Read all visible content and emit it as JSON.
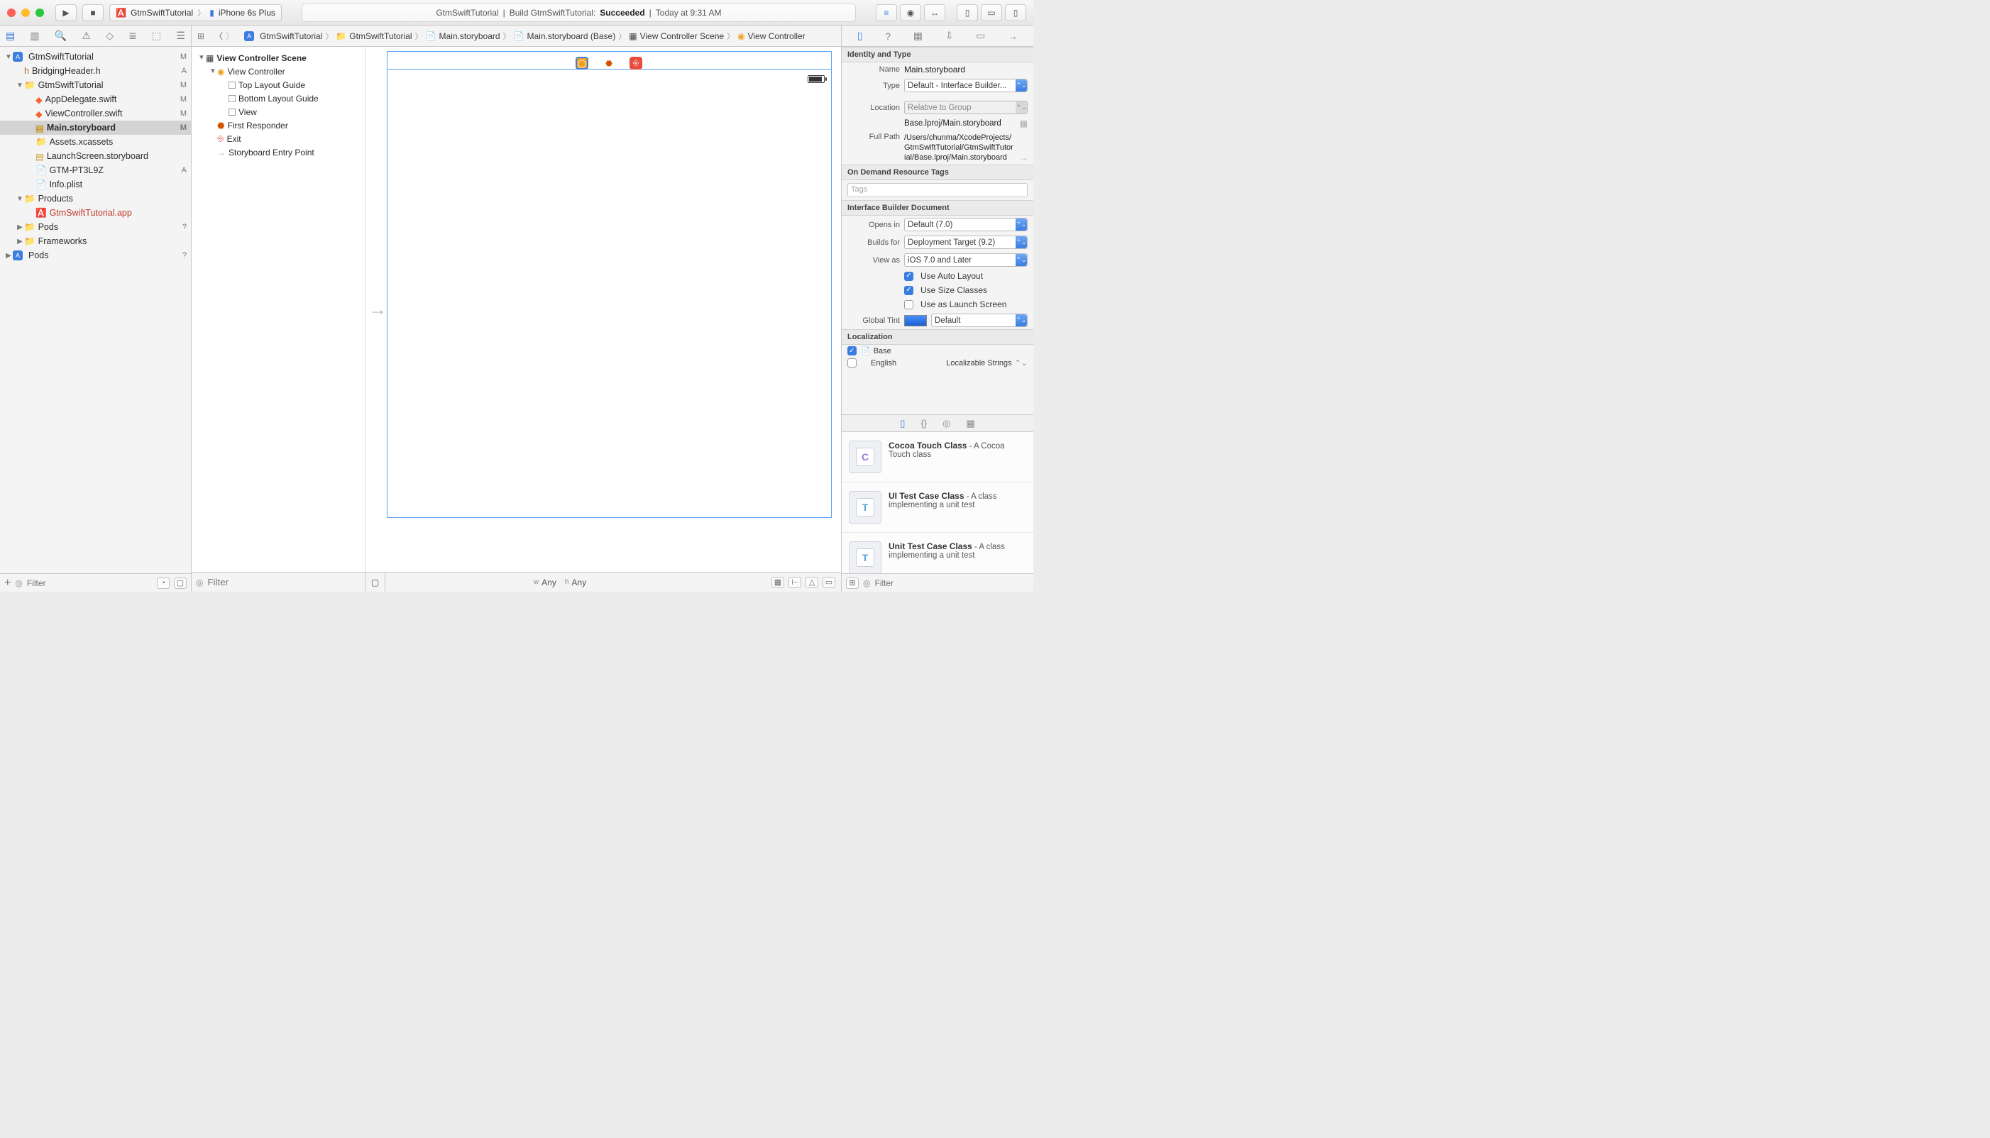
{
  "toolbar": {
    "scheme_target": "GtmSwiftTutorial",
    "scheme_device": "iPhone 6s Plus"
  },
  "status": {
    "project": "GtmSwiftTutorial",
    "action": "Build GtmSwiftTutorial:",
    "result": "Succeeded",
    "time": "Today at 9:31 AM"
  },
  "breadcrumb": [
    "GtmSwiftTutorial",
    "GtmSwiftTutorial",
    "Main.storyboard",
    "Main.storyboard (Base)",
    "View Controller Scene",
    "View Controller"
  ],
  "navigator": {
    "rows": [
      {
        "indent": 0,
        "disc": "▼",
        "icon": "proj",
        "label": "GtmSwiftTutorial",
        "badge": "M"
      },
      {
        "indent": 1,
        "disc": "",
        "icon": "h",
        "label": "BridgingHeader.h",
        "badge": "A"
      },
      {
        "indent": 1,
        "disc": "▼",
        "icon": "folder",
        "label": "GtmSwiftTutorial",
        "badge": "M"
      },
      {
        "indent": 2,
        "disc": "",
        "icon": "swift",
        "label": "AppDelegate.swift",
        "badge": "M"
      },
      {
        "indent": 2,
        "disc": "",
        "icon": "swift",
        "label": "ViewController.swift",
        "badge": "M"
      },
      {
        "indent": 2,
        "disc": "",
        "icon": "storyboard",
        "label": "Main.storyboard",
        "badge": "M",
        "sel": true
      },
      {
        "indent": 2,
        "disc": "",
        "icon": "assets",
        "label": "Assets.xcassets",
        "badge": ""
      },
      {
        "indent": 2,
        "disc": "",
        "icon": "storyboard",
        "label": "LaunchScreen.storyboard",
        "badge": ""
      },
      {
        "indent": 2,
        "disc": "",
        "icon": "cfg",
        "label": "GTM-PT3L9Z",
        "badge": "A"
      },
      {
        "indent": 2,
        "disc": "",
        "icon": "plist",
        "label": "Info.plist",
        "badge": ""
      },
      {
        "indent": 1,
        "disc": "▼",
        "icon": "folder",
        "label": "Products",
        "badge": ""
      },
      {
        "indent": 2,
        "disc": "",
        "icon": "app",
        "label": "GtmSwiftTutorial.app",
        "badge": "",
        "red": true
      },
      {
        "indent": 1,
        "disc": "▶",
        "icon": "folder",
        "label": "Pods",
        "badge": "?"
      },
      {
        "indent": 1,
        "disc": "▶",
        "icon": "folder",
        "label": "Frameworks",
        "badge": ""
      },
      {
        "indent": 0,
        "disc": "▶",
        "icon": "proj",
        "label": "Pods",
        "badge": "?"
      }
    ],
    "filter_placeholder": "Filter"
  },
  "outline": {
    "scene": "View Controller Scene",
    "rows": [
      {
        "indent": 0,
        "disc": "▼",
        "icon": "scene",
        "label": "View Controller Scene",
        "bold": true
      },
      {
        "indent": 1,
        "disc": "▼",
        "icon": "vc",
        "label": "View Controller"
      },
      {
        "indent": 2,
        "disc": "",
        "icon": "guide",
        "label": "Top Layout Guide"
      },
      {
        "indent": 2,
        "disc": "",
        "icon": "guide",
        "label": "Bottom Layout Guide"
      },
      {
        "indent": 2,
        "disc": "",
        "icon": "view",
        "label": "View"
      },
      {
        "indent": 1,
        "disc": "",
        "icon": "responder",
        "label": "First Responder"
      },
      {
        "indent": 1,
        "disc": "",
        "icon": "exit",
        "label": "Exit"
      },
      {
        "indent": 1,
        "disc": "",
        "icon": "entry",
        "label": "Storyboard Entry Point"
      }
    ],
    "filter_placeholder": "Filter"
  },
  "size_class": {
    "w": "Any",
    "h": "Any",
    "prefix_w": "w",
    "prefix_h": "h"
  },
  "inspector": {
    "identity_header": "Identity and Type",
    "name_label": "Name",
    "name_value": "Main.storyboard",
    "type_label": "Type",
    "type_value": "Default - Interface Builder...",
    "location_label": "Location",
    "location_value": "Relative to Group",
    "rel_path": "Base.lproj/Main.storyboard",
    "fullpath_label": "Full Path",
    "fullpath_value": "/Users/chunma/XcodeProjects/GtmSwiftTutorial/GtmSwiftTutorial/Base.lproj/Main.storyboard",
    "odr_header": "On Demand Resource Tags",
    "odr_placeholder": "Tags",
    "ibd_header": "Interface Builder Document",
    "opens_label": "Opens in",
    "opens_value": "Default (7.0)",
    "builds_label": "Builds for",
    "builds_value": "Deployment Target (9.2)",
    "viewas_label": "View as",
    "viewas_value": "iOS 7.0 and Later",
    "auto_layout": "Use Auto Layout",
    "size_classes": "Use Size Classes",
    "launch_screen": "Use as Launch Screen",
    "tint_label": "Global Tint",
    "tint_value": "Default",
    "loc_header": "Localization",
    "loc_base": "Base",
    "loc_english": "English",
    "loc_english_type": "Localizable Strings"
  },
  "library": {
    "items": [
      {
        "glyph": "C",
        "color": "#9b7bd4",
        "title": "Cocoa Touch Class",
        "desc": " - A Cocoa Touch class"
      },
      {
        "glyph": "T",
        "color": "#5aa6d8",
        "title": "UI Test Case Class",
        "desc": " - A class implementing a unit test"
      },
      {
        "glyph": "T",
        "color": "#5aa6d8",
        "title": "Unit Test Case Class",
        "desc": " - A class implementing a unit test"
      }
    ],
    "filter_placeholder": "Filter"
  }
}
